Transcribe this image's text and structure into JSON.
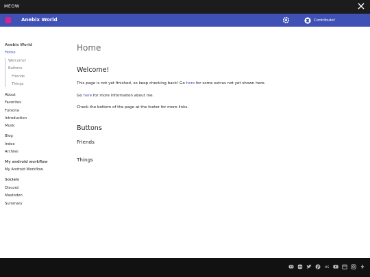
{
  "window": {
    "title": "MEOW"
  },
  "navbar": {
    "site_title": "Anebix World",
    "contribute_label": "Contribute!",
    "accent_color": "#3f51b5",
    "logo_color": "#e91e8c"
  },
  "sidebar": {
    "items": [
      {
        "label": "Anebix World",
        "kind": "head"
      },
      {
        "label": "Home",
        "kind": "active"
      },
      {
        "label": "Welcome!",
        "kind": "sub"
      },
      {
        "label": "Buttons",
        "kind": "sub"
      },
      {
        "label": "Friends",
        "kind": "sub2"
      },
      {
        "label": "Things",
        "kind": "sub2"
      },
      {
        "label": "About",
        "kind": "link"
      },
      {
        "label": "Favorites",
        "kind": "link"
      },
      {
        "label": "Fursona",
        "kind": "link"
      },
      {
        "label": "Introduction",
        "kind": "link"
      },
      {
        "label": "Music",
        "kind": "link"
      },
      {
        "label": "Blog",
        "kind": "link"
      },
      {
        "label": "Index",
        "kind": "link"
      },
      {
        "label": "Archive",
        "kind": "link"
      },
      {
        "label": "My android workflow",
        "kind": "head"
      },
      {
        "label": "My Android Workflow",
        "kind": "link"
      },
      {
        "label": "Socials",
        "kind": "head"
      },
      {
        "label": "Discord",
        "kind": "link"
      },
      {
        "label": "Mastodon",
        "kind": "link"
      },
      {
        "label": "Summary",
        "kind": "link"
      }
    ]
  },
  "main": {
    "page_title": "Home",
    "welcome_heading": "Welcome!",
    "p1_before": "This page is not yet finished, so keep checking back! Go ",
    "p1_link": "here",
    "p1_after": " for some extras not yet shown here.",
    "p2_before": "Go ",
    "p2_link": "here",
    "p2_after": " for more information about me.",
    "p3": "Check the bottom of the page at the footer for more links.",
    "buttons_heading": "Buttons",
    "friends_heading": "Friends",
    "things_heading": "Things"
  },
  "footer": {
    "icons": [
      "discord-icon",
      "mastodon-icon",
      "twitter-icon",
      "pinterest-icon",
      "os-icon",
      "youtube-icon",
      "calendar-icon",
      "instagram-icon",
      "bolt-icon"
    ]
  }
}
